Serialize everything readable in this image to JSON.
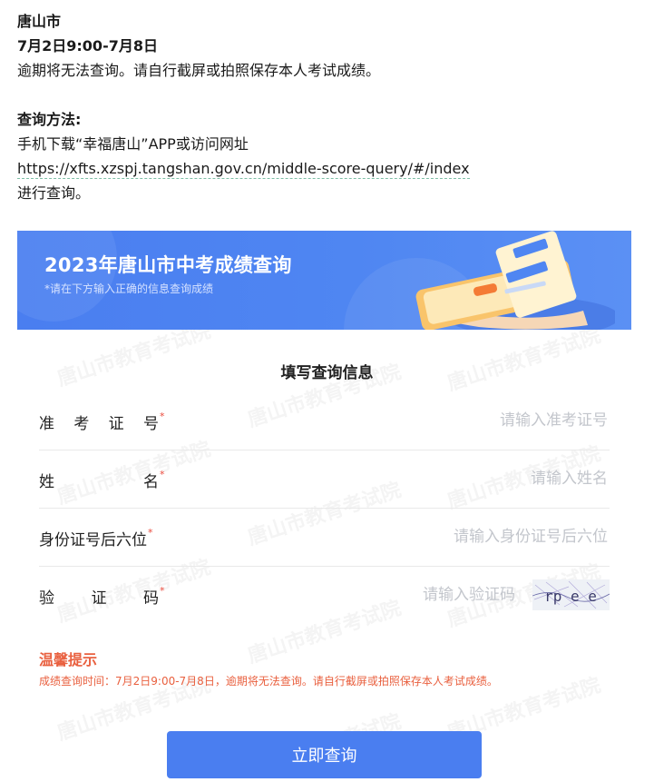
{
  "article": {
    "city": "唐山市",
    "period": "7月2日9:00-7月8日",
    "notice": "逾期将无法查询。请自行截屏或拍照保存本人考试成绩。",
    "method_title": "查询方法:",
    "method_line": "手机下载“幸福唐山”APP或访问网址",
    "url": "https://xfts.xzspj.tangshan.gov.cn/middle-score-query/#/index",
    "suffix": "进行查询。"
  },
  "banner": {
    "title": "2023年唐山市中考成绩查询",
    "subtitle": "*请在下方输入正确的信息查询成绩"
  },
  "watermark": "唐山市教育考试院",
  "form": {
    "title": "填写查询信息",
    "fields": [
      {
        "label": "准考证号",
        "placeholder": "请输入准考证号",
        "value": ""
      },
      {
        "label": "姓名",
        "placeholder": "请输入姓名",
        "value": ""
      },
      {
        "label": "身份证号后六位",
        "placeholder": "请输入身份证号后六位",
        "value": ""
      },
      {
        "label": "验证码",
        "placeholder": "请输入验证码",
        "value": ""
      }
    ],
    "required_mark": "*",
    "captcha_text": "rp e e"
  },
  "tips": {
    "title": "温馨提示",
    "text": "成绩查询时间：7月2日9:00-7月8日，逾期将无法查询。请自行截屏或拍照保存本人考试成绩。"
  },
  "submit_label": "立即查询",
  "colors": {
    "primary": "#4a7ef0",
    "warning": "#e9603f",
    "required": "#e94a3c"
  }
}
